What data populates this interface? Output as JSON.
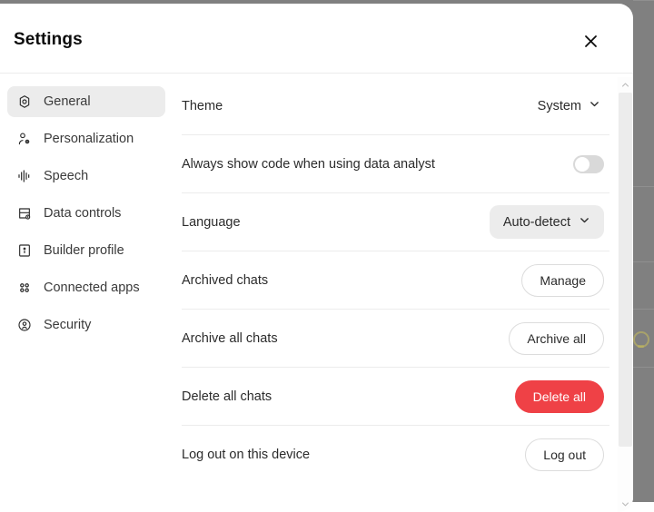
{
  "header": {
    "title": "Settings",
    "close_icon": "close-icon"
  },
  "sidebar": {
    "items": [
      {
        "label": "General",
        "icon": "gear-icon",
        "selected": true
      },
      {
        "label": "Personalization",
        "icon": "person-icon",
        "selected": false
      },
      {
        "label": "Speech",
        "icon": "waveform-icon",
        "selected": false
      },
      {
        "label": "Data controls",
        "icon": "database-icon",
        "selected": false
      },
      {
        "label": "Builder profile",
        "icon": "id-card-icon",
        "selected": false
      },
      {
        "label": "Connected apps",
        "icon": "grid-dots-icon",
        "selected": false
      },
      {
        "label": "Security",
        "icon": "shield-badge-icon",
        "selected": false
      }
    ]
  },
  "settings": {
    "rows": [
      {
        "label": "Theme",
        "control": "theme-select",
        "value": "System"
      },
      {
        "label": "Always show code when using data analyst",
        "control": "code-toggle",
        "value": "off"
      },
      {
        "label": "Language",
        "control": "language-select",
        "value": "Auto-detect"
      },
      {
        "label": "Archived chats",
        "control": "manage-button",
        "value": "Manage"
      },
      {
        "label": "Archive all chats",
        "control": "archive-all-button",
        "value": "Archive all"
      },
      {
        "label": "Delete all chats",
        "control": "delete-all-button",
        "value": "Delete all"
      },
      {
        "label": "Log out on this device",
        "control": "log-out-button",
        "value": "Log out"
      }
    ]
  },
  "colors": {
    "danger": "#ef4146",
    "selected_bg": "#ececec",
    "divider": "#ececec",
    "backdrop": "#808080"
  },
  "scrollbar": {
    "up_icon": "chevron-up-icon",
    "down_icon": "chevron-down-icon"
  }
}
